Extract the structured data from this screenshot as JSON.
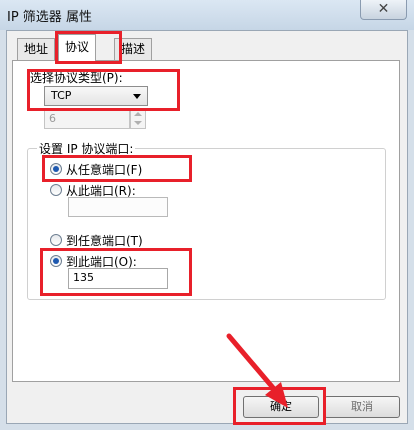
{
  "window": {
    "title": "IP 筛选器 属性",
    "close_glyph": "✕"
  },
  "tabs": [
    {
      "label": "地址",
      "active": false
    },
    {
      "label": "协议",
      "active": true
    },
    {
      "label": "描述",
      "active": false
    }
  ],
  "protocol": {
    "type_label": "选择协议类型(P):",
    "selected": "TCP",
    "number_value": "6"
  },
  "ports": {
    "group_label": "设置 IP 协议端口:",
    "from_any": "从任意端口(F)",
    "from_this": "从此端口(R):",
    "from_value": "",
    "to_any": "到任意端口(T)",
    "to_this": "到此端口(O):",
    "to_value": "135",
    "selected_from": "from_any",
    "selected_to": "to_this"
  },
  "buttons": {
    "ok": "确定",
    "cancel": "取消"
  },
  "colors": {
    "highlight": "#e8202a",
    "radio_dot": "#1e59b0"
  }
}
